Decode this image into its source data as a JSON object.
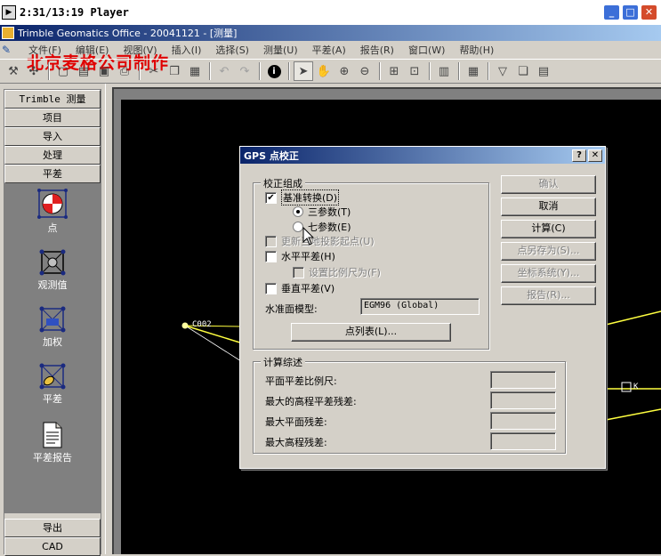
{
  "player": {
    "title": "2:31/13:19 Player"
  },
  "app": {
    "title": "Trimble Geomatics Office - 20041121 - [测量]"
  },
  "watermark": "北京麦格公司制作",
  "menu": [
    "文件(F)",
    "编辑(E)",
    "视图(V)",
    "插入(I)",
    "选择(S)",
    "测量(U)",
    "平差(A)",
    "报告(R)",
    "窗口(W)",
    "帮助(H)"
  ],
  "left_panel": {
    "headers": [
      "Trimble 测量",
      "项目",
      "导入",
      "处理",
      "平差"
    ],
    "tools": [
      "点",
      "观测值",
      "加权",
      "平差",
      "平差报告"
    ],
    "footer": [
      "导出",
      "CAD"
    ]
  },
  "canvas": {
    "point_label": "C002",
    "right_label": "K"
  },
  "dialog": {
    "title": "GPS 点校正",
    "group1": {
      "title": "校正组成",
      "datum_transform": "基准转换(D)",
      "three_param": "三参数(T)",
      "seven_param": "七参数(E)",
      "update_origin": "更新当地投影起点(U)",
      "horizontal_adj": "水平平差(H)",
      "set_scale": "设置比例尺为(F)",
      "vertical_adj": "垂直平差(V)",
      "geoid_label": "水准面模型:",
      "geoid_value": "EGM96 (Global)",
      "point_list_btn": "点列表(L)..."
    },
    "group2": {
      "title": "计算综述",
      "rows": [
        "平面平差比例尺:",
        "最大的高程平差残差:",
        "最大平面残差:",
        "最大高程残差:"
      ]
    },
    "buttons": [
      "确认",
      "取消",
      "计算(C)",
      "点另存为(S)...",
      "坐标系统(Y)...",
      "报告(R)..."
    ]
  }
}
